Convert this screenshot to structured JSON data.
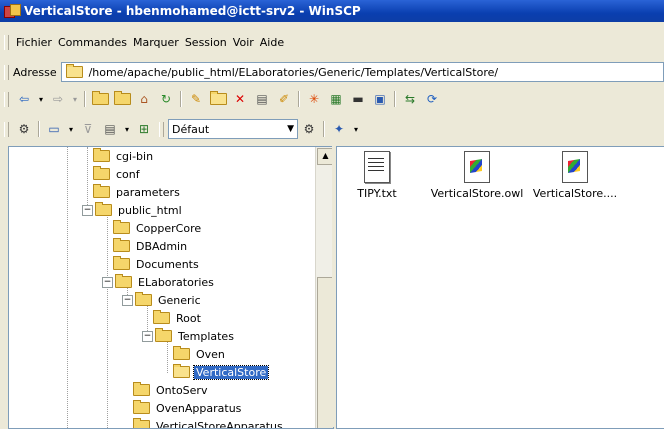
{
  "window": {
    "title": "VerticalStore - hbenmohamed@ictt-srv2 - WinSCP"
  },
  "menu": [
    "Fichier",
    "Commandes",
    "Marquer",
    "Session",
    "Voir",
    "Aide"
  ],
  "address": {
    "label": "Adresse",
    "path": "/home/apache/public_html/ELaboratories/Generic/Templates/VerticalStore/"
  },
  "toolbar2": {
    "transfer_preset": "Défaut"
  },
  "tree": [
    {
      "label": "cgi-bin",
      "icon": "folder"
    },
    {
      "label": "conf",
      "icon": "folder-link"
    },
    {
      "label": "parameters",
      "icon": "folder"
    },
    {
      "label": "public_html",
      "icon": "folder",
      "expanded": true
    },
    {
      "label": "CopperCore",
      "icon": "folder"
    },
    {
      "label": "DBAdmin",
      "icon": "folder"
    },
    {
      "label": "Documents",
      "icon": "folder"
    },
    {
      "label": "ELaboratories",
      "icon": "folder",
      "expanded": true
    },
    {
      "label": "Generic",
      "icon": "folder",
      "expanded": true
    },
    {
      "label": "Root",
      "icon": "folder"
    },
    {
      "label": "Templates",
      "icon": "folder",
      "expanded": true
    },
    {
      "label": "Oven",
      "icon": "folder"
    },
    {
      "label": "VerticalStore",
      "icon": "folder-open",
      "selected": true
    },
    {
      "label": "OntoServ",
      "icon": "folder"
    },
    {
      "label": "OvenApparatus",
      "icon": "folder"
    },
    {
      "label": "VerticalStoreApparatus",
      "icon": "folder"
    }
  ],
  "files": [
    {
      "name": "TIPY.txt",
      "icon": "text-file-icon"
    },
    {
      "name": "VerticalStore.owl",
      "icon": "owl-file-icon"
    },
    {
      "name": "VerticalStore....",
      "icon": "owl-file-icon"
    }
  ]
}
